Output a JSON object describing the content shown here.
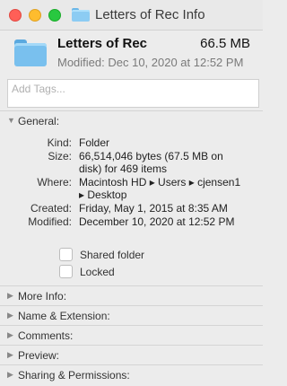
{
  "window": {
    "title": "Letters of Rec Info"
  },
  "item": {
    "name": "Letters of Rec",
    "size": "66.5 MB",
    "modified": "Modified: Dec 10, 2020 at 12:52 PM"
  },
  "tags": {
    "placeholder": "Add Tags..."
  },
  "general": {
    "label": "General:",
    "kind_label": "Kind:",
    "kind": "Folder",
    "size_label": "Size:",
    "size_line1": "66,514,046 bytes (67.5 MB on",
    "size_line2": "disk) for 469 items",
    "where_label": "Where:",
    "where_line1": "Macintosh HD ▸ Users ▸ cjensen1",
    "where_line2": "▸ Desktop",
    "created_label": "Created:",
    "created": "Friday, May 1, 2015 at 8:35 AM",
    "modified_label": "Modified:",
    "modified": "December 10, 2020 at 12:52 PM",
    "shared_folder": "Shared folder",
    "locked": "Locked"
  },
  "sections": [
    {
      "label": "More Info:"
    },
    {
      "label": "Name & Extension:"
    },
    {
      "label": "Comments:"
    },
    {
      "label": "Preview:"
    },
    {
      "label": "Sharing & Permissions:"
    }
  ],
  "icons": {
    "window_folder": "folder-icon",
    "item_folder": "folder-icon",
    "expanded": "disclosure-triangle-down-icon",
    "collapsed": "disclosure-triangle-right-icon"
  }
}
